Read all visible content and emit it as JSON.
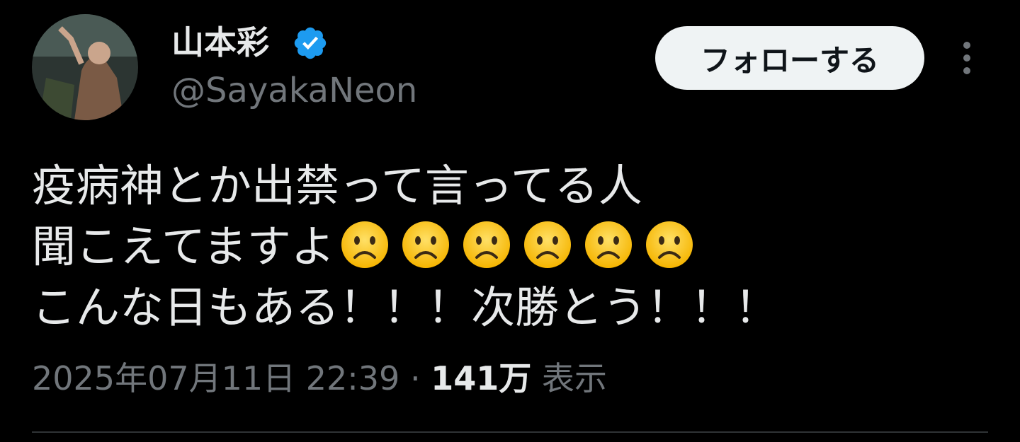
{
  "author": {
    "display_name": "山本彩",
    "handle": "@SayakaNeon",
    "verified": true
  },
  "follow_button": {
    "label": "フォローする"
  },
  "tweet": {
    "lines": [
      "疫病神とか出禁って言ってる人",
      "聞こえてますよ",
      "こんな日もある！！！次勝とう！！！"
    ],
    "emoji_after_line_2": [
      "frowning-face",
      "frowning-face",
      "frowning-face",
      "frowning-face",
      "frowning-face",
      "frowning-face"
    ]
  },
  "meta": {
    "datetime": "2025年07月11日 22:39",
    "separator": " · ",
    "views_count": "141万",
    "views_label": " 表示"
  },
  "colors": {
    "background": "#000000",
    "text_primary": "#e7e9ea",
    "text_secondary": "#71767b",
    "verified_blue": "#1d9bf0",
    "follow_button_bg": "#eff3f4",
    "follow_button_text": "#0f1419",
    "divider": "#2f3336"
  }
}
